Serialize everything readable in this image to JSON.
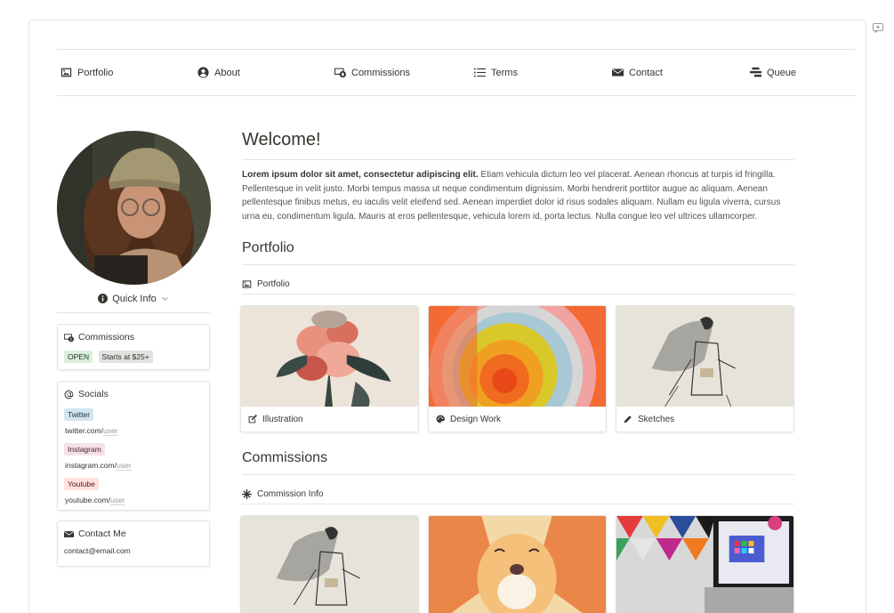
{
  "nav": {
    "items": [
      {
        "label": "Portfolio",
        "icon": "image-icon"
      },
      {
        "label": "About",
        "icon": "user-circle-icon"
      },
      {
        "label": "Commissions",
        "icon": "money-icon"
      },
      {
        "label": "Terms",
        "icon": "list-icon"
      },
      {
        "label": "Contact",
        "icon": "envelope-icon"
      },
      {
        "label": "Queue",
        "icon": "stack-icon"
      }
    ]
  },
  "sidebar": {
    "quick_info": "Quick Info",
    "commissions": {
      "title": "Commissions",
      "status": "OPEN",
      "price": "Starts at $25+"
    },
    "socials": {
      "title": "Socials",
      "links": [
        {
          "tag": "Twitter",
          "prefix": "twitter.com/",
          "handle": "user"
        },
        {
          "tag": "Instagram",
          "prefix": "instagram.com/",
          "handle": "user"
        },
        {
          "tag": "Youtube",
          "prefix": "youtube.com/",
          "handle": "user"
        }
      ]
    },
    "contact": {
      "title": "Contact Me",
      "email": "contact@email.com"
    }
  },
  "main": {
    "title": "Welcome!",
    "intro_bold": "Lorem ipsum dolor sit amet, consectetur adipiscing elit.",
    "intro_rest": " Etiam vehicula dictum leo vel placerat. Aenean rhoncus at turpis id fringilla. Pellentesque in velit justo. Morbi tempus massa ut neque condimentum dignissim. Morbi hendrerit porttitor augue ac aliquam. Aenean pellentesque finibus metus, eu iaculis velit eleifend sed. Aenean imperdiet dolor id risus sodales aliquam. Nullam eu ligula viverra, cursus urna eu, condimentum ligula. Mauris at eros pellentesque, vehicula lorem id, porta lectus. Nulla congue leo vel ultrices ullamcorper.",
    "portfolio_heading": "Portfolio",
    "portfolio_link": "Portfolio",
    "portfolio_cards": [
      {
        "label": "Illustration",
        "icon": "edit-icon"
      },
      {
        "label": "Design Work",
        "icon": "palette-icon"
      },
      {
        "label": "Sketches",
        "icon": "pencil-icon"
      }
    ],
    "commissions_heading": "Commissions",
    "commissions_link": "Commission Info"
  },
  "colors": {
    "accent_text": "#37352f",
    "border": "#e4e4e2"
  }
}
